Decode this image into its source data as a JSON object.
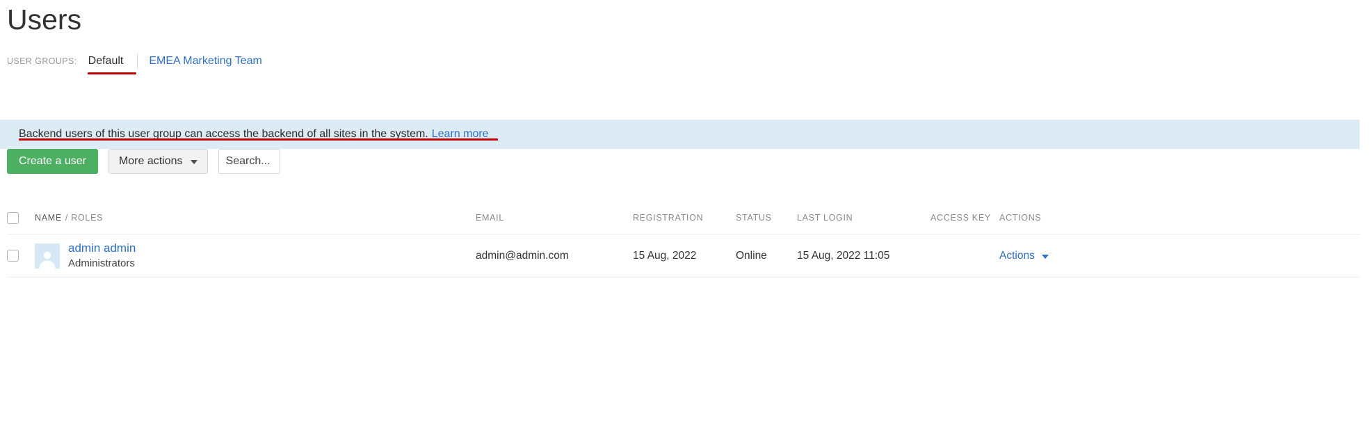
{
  "page": {
    "title": "Users"
  },
  "user_groups": {
    "label": "USER GROUPS:",
    "tabs": [
      {
        "label": "Default",
        "active": true
      },
      {
        "label": "EMEA Marketing Team",
        "active": false
      }
    ]
  },
  "info_banner": {
    "text": "Backend users of this user group can access the backend of all sites in the system.",
    "link_label": "Learn more",
    "background_color": "#ddebf5"
  },
  "toolbar": {
    "create_label": "Create a user",
    "more_actions_label": "More actions",
    "search_value": "",
    "search_placeholder": "Search...",
    "create_button_color": "#4caf62"
  },
  "annotations": {
    "color": "#c00000"
  },
  "table": {
    "columns": [
      {
        "key": "name",
        "label_strong": "NAME",
        "label_rest": "/ ROLES"
      },
      {
        "key": "email",
        "label": "EMAIL"
      },
      {
        "key": "registration",
        "label": "REGISTRATION"
      },
      {
        "key": "status",
        "label": "STATUS"
      },
      {
        "key": "last_login",
        "label": "LAST LOGIN"
      },
      {
        "key": "access_key",
        "label": "ACCESS KEY"
      },
      {
        "key": "actions",
        "label": "ACTIONS"
      }
    ],
    "rows": [
      {
        "name": "admin admin",
        "role": "Administrators",
        "email": "admin@admin.com",
        "registration": "15 Aug, 2022",
        "status": "Online",
        "last_login": "15 Aug, 2022 11:05",
        "access_key": "",
        "actions_label": "Actions"
      }
    ]
  }
}
